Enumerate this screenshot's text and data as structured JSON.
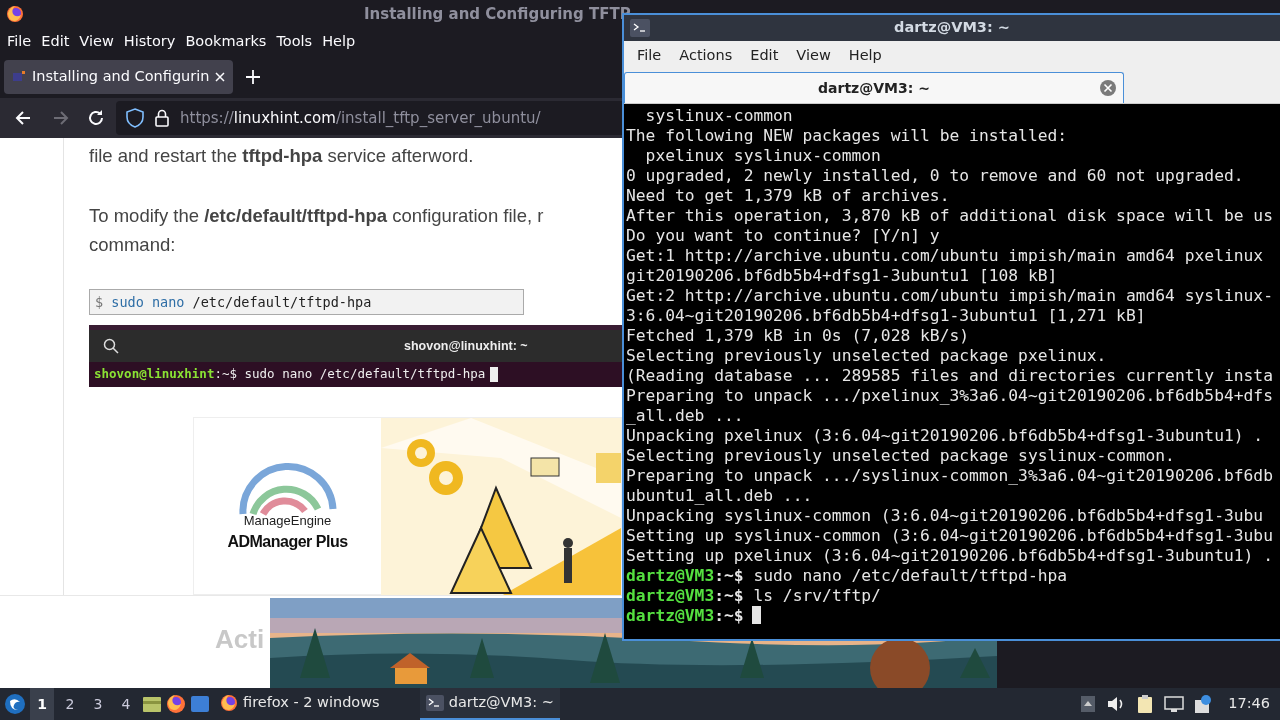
{
  "firefox": {
    "title": "Installing and Configuring TFTP",
    "menu": [
      "File",
      "Edit",
      "View",
      "History",
      "Bookmarks",
      "Tools",
      "Help"
    ],
    "tabs": [
      {
        "label": "Installing and Configurin",
        "selected": true
      }
    ],
    "nav_buttons": [
      {
        "kind": "back",
        "disabled": false
      },
      {
        "kind": "forward",
        "disabled": true
      },
      {
        "kind": "reload",
        "disabled": false
      }
    ],
    "url": {
      "scheme": "https://",
      "host": "linuxhint.com",
      "path": "/install_tftp_server_ubuntu/"
    },
    "article": {
      "paragraphs": [
        {
          "lines": [
            "file and restart the **tftpd-hpa** service afterword."
          ]
        },
        {
          "lines": [
            "To modify the **/etc/default/tftpd-hpa** configuration file, r",
            "command:"
          ]
        }
      ],
      "code": {
        "prompt": "$",
        "command": "sudo nano",
        "args": "/etc/default/tftpd-hpa"
      },
      "screenshot": {
        "title": "shovon@linuxhint: ~",
        "user": "shovon@linuxhint",
        "symbol": ":~$",
        "command": "sudo nano /etc/default/tftpd-hpa"
      },
      "ad": {
        "brand": "ManageEngine",
        "product": "ADManager Plus"
      },
      "footer_text": "Acti"
    }
  },
  "terminal": {
    "title": "dartz@VM3: ~",
    "menu": [
      "File",
      "Actions",
      "Edit",
      "View",
      "Help"
    ],
    "tabs": [
      {
        "label": "dartz@VM3: ~",
        "selected": true
      }
    ],
    "lines": [
      {
        "kind": "output",
        "text": "  syslinux-common"
      },
      {
        "kind": "output",
        "text": "The following NEW packages will be installed:"
      },
      {
        "kind": "output",
        "text": "  pxelinux syslinux-common"
      },
      {
        "kind": "output",
        "text": "0 upgraded, 2 newly installed, 0 to remove and 60 not upgraded."
      },
      {
        "kind": "output",
        "text": "Need to get 1,379 kB of archives."
      },
      {
        "kind": "output",
        "text": "After this operation, 3,870 kB of additional disk space will be us"
      },
      {
        "kind": "output",
        "text": "Do you want to continue? [Y/n] y"
      },
      {
        "kind": "output",
        "text": "Get:1 http://archive.ubuntu.com/ubuntu impish/main amd64 pxelinux"
      },
      {
        "kind": "output",
        "text": "git20190206.bf6db5b4+dfsg1-3ubuntu1 [108 kB]"
      },
      {
        "kind": "output",
        "text": "Get:2 http://archive.ubuntu.com/ubuntu impish/main amd64 syslinux-"
      },
      {
        "kind": "output",
        "text": "3:6.04~git20190206.bf6db5b4+dfsg1-3ubuntu1 [1,271 kB]"
      },
      {
        "kind": "output",
        "text": "Fetched 1,379 kB in 0s (7,028 kB/s)"
      },
      {
        "kind": "output",
        "text": "Selecting previously unselected package pxelinux."
      },
      {
        "kind": "output",
        "text": "(Reading database ... 289585 files and directories currently insta"
      },
      {
        "kind": "output",
        "text": "Preparing to unpack .../pxelinux_3%3a6.04~git20190206.bf6db5b4+dfs"
      },
      {
        "kind": "output",
        "text": "_all.deb ..."
      },
      {
        "kind": "output",
        "text": "Unpacking pxelinux (3:6.04~git20190206.bf6db5b4+dfsg1-3ubuntu1) ."
      },
      {
        "kind": "output",
        "text": "Selecting previously unselected package syslinux-common."
      },
      {
        "kind": "output",
        "text": "Preparing to unpack .../syslinux-common_3%3a6.04~git20190206.bf6db"
      },
      {
        "kind": "output",
        "text": "ubuntu1_all.deb ..."
      },
      {
        "kind": "output",
        "text": "Unpacking syslinux-common (3:6.04~git20190206.bf6db5b4+dfsg1-3ubu"
      },
      {
        "kind": "output",
        "text": "Setting up syslinux-common (3:6.04~git20190206.bf6db5b4+dfsg1-3ubu"
      },
      {
        "kind": "output",
        "text": "Setting up pxelinux (3:6.04~git20190206.bf6db5b4+dfsg1-3ubuntu1) ."
      },
      {
        "kind": "prompt",
        "user": "dartz@VM3",
        "symbol": ":~$",
        "command": "sudo nano /etc/default/tftpd-hpa",
        "cursor": false
      },
      {
        "kind": "prompt",
        "user": "dartz@VM3",
        "symbol": ":~$",
        "command": "ls /srv/tftp/",
        "cursor": false
      },
      {
        "kind": "prompt",
        "user": "dartz@VM3",
        "symbol": ":~$",
        "cursor": true
      }
    ]
  },
  "taskbar": {
    "workspaces": [
      {
        "label": "1",
        "selected": true
      },
      {
        "label": "2",
        "selected": false
      },
      {
        "label": "3",
        "selected": false
      },
      {
        "label": "4",
        "selected": false
      }
    ],
    "tasks": [
      {
        "kind": "firefox",
        "label": "firefox - 2 windows",
        "selected": false
      },
      {
        "kind": "terminal",
        "label": "dartz@VM3: ~",
        "selected": true
      }
    ],
    "clock": "17:46"
  }
}
